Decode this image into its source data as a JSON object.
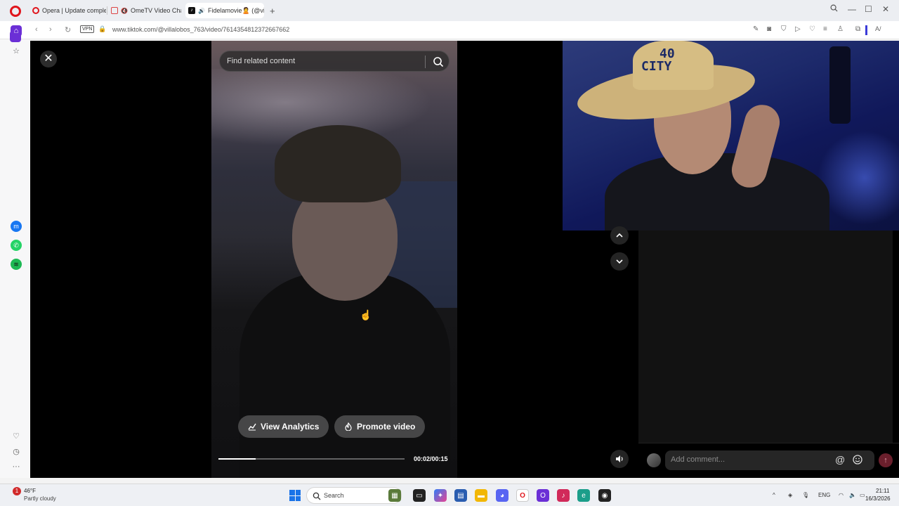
{
  "browser": {
    "tabs": [
      {
        "title": "Opera | Update complete",
        "icon": "opera-icon"
      },
      {
        "title": "OmeTV Video Chat -",
        "icon": "ometv-icon"
      },
      {
        "title": "Fidelamovie🙎 (@vill",
        "icon": "tiktok-icon"
      }
    ],
    "new_tab": "+",
    "vpn_label": "VPN",
    "url": "www.tiktok.com/@villalobos_763/video/7614354812372667662"
  },
  "player": {
    "search_placeholder": "Find related content",
    "view_analytics": "View Analytics",
    "promote_video": "Promote video",
    "time": "00:02/00:15",
    "progress": 0.2
  },
  "webcam": {
    "hat_text_1": "40",
    "hat_text_2": "CITY"
  },
  "comments": {
    "placeholder": "Add comment...",
    "at_symbol": "@"
  },
  "taskbar": {
    "weather_badge": "1",
    "temperature": "46°F",
    "condition": "Partly cloudy",
    "search": "Search",
    "language": "ENG",
    "time": "21:11",
    "date": "16/3/2026"
  },
  "colors": {
    "accent_red": "#e0151c",
    "send_button": "#6a1f2c",
    "windows_blue": "#1a73e8"
  }
}
